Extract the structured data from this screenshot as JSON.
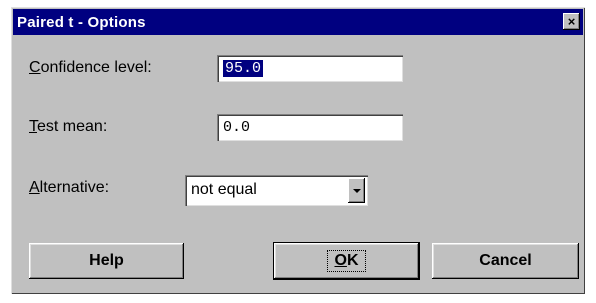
{
  "window": {
    "title": "Paired t - Options",
    "close_glyph": "×"
  },
  "fields": {
    "confidence": {
      "label_key": "C",
      "label_rest": "onfidence level:",
      "value": "95.0"
    },
    "test_mean": {
      "label_key": "T",
      "label_rest": "est mean:",
      "value": "0.0"
    },
    "alternative": {
      "label_key": "A",
      "label_rest": "lternative:",
      "value": "not equal"
    }
  },
  "buttons": {
    "help": "Help",
    "ok_key": "O",
    "ok_rest": "K",
    "cancel": "Cancel"
  },
  "icons": {
    "close": "close-icon",
    "dropdown": "chevron-down-icon"
  },
  "colors": {
    "dialog_face": "#c0c0c0",
    "titlebar": "#000080",
    "selection": "#000080"
  }
}
